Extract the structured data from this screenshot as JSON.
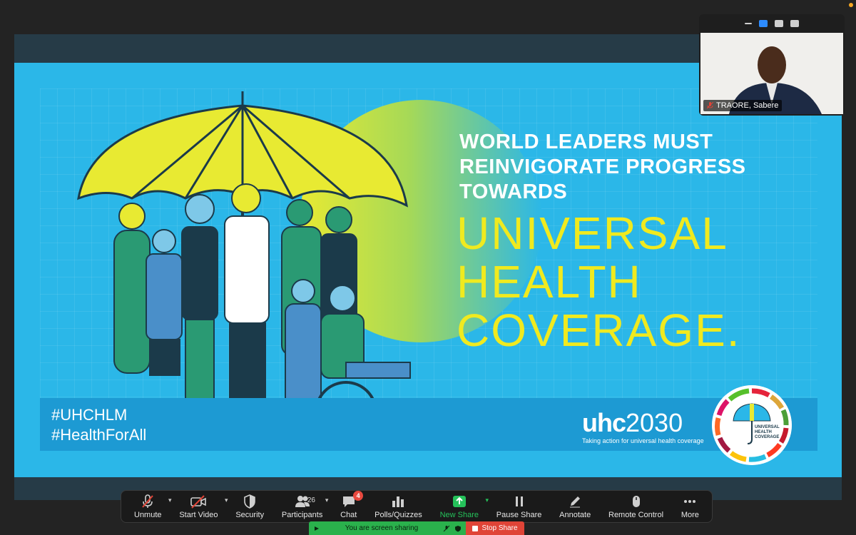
{
  "slide": {
    "headline_lines": [
      "WORLD LEADERS MUST",
      "REINVIGORATE PROGRESS",
      "TOWARDS"
    ],
    "big_lines": [
      "UNIVERSAL",
      "HEALTH",
      "COVERAGE."
    ],
    "hashtags": [
      "#UHCHLM",
      "#HealthForAll"
    ],
    "uhc_logo_bold": "uhc",
    "uhc_logo_year": "2030",
    "uhc_tagline": "Taking action for universal health coverage",
    "emblem_lines": [
      "UNIVERSAL",
      "HEALTH",
      "COVERAGE"
    ]
  },
  "self_view": {
    "name": "TRAORE, Sabere"
  },
  "toolbar": {
    "items": [
      {
        "label": "Unmute",
        "icon": "mic-muted-icon"
      },
      {
        "label": "Start Video",
        "icon": "video-off-icon"
      },
      {
        "label": "Security",
        "icon": "shield-icon"
      },
      {
        "label": "Participants",
        "icon": "participants-icon",
        "count": "26"
      },
      {
        "label": "Chat",
        "icon": "chat-icon",
        "badge": "4"
      },
      {
        "label": "Polls/Quizzes",
        "icon": "bar-chart-icon"
      },
      {
        "label": "New Share",
        "icon": "share-up-arrow-icon"
      },
      {
        "label": "Pause Share",
        "icon": "pause-icon"
      },
      {
        "label": "Annotate",
        "icon": "pencil-icon"
      },
      {
        "label": "Remote Control",
        "icon": "mouse-icon"
      },
      {
        "label": "More",
        "icon": "more-dots-icon"
      }
    ]
  },
  "share_bar": {
    "status": "You are screen sharing",
    "stop_label": "Stop Share"
  },
  "colors": {
    "slide_blue": "#2bb7e8",
    "headline_yellow": "#f0ea1f",
    "share_green": "#2ab14c",
    "stop_red": "#e04437"
  }
}
